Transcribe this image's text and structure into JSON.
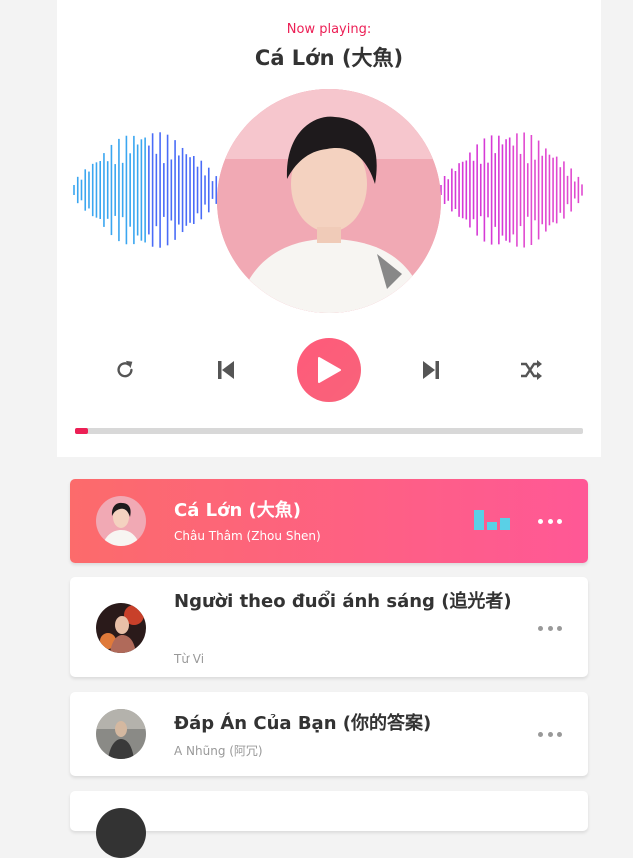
{
  "header": {
    "now_label": "Now playing:",
    "title": "Cá Lớn (大魚)"
  },
  "controls": {
    "repeat_icon": "repeat-icon",
    "prev_icon": "skip-previous-icon",
    "play_icon": "play-icon",
    "next_icon": "skip-next-icon",
    "shuffle_icon": "shuffle-icon"
  },
  "progress": {
    "value": 0.026
  },
  "colors": {
    "accent": "#ec1f55",
    "active_from": "#fc6b6b",
    "active_to": "#ff5896",
    "wave_left": "#4a6cf7",
    "wave_right": "#d63ad6"
  },
  "playlist": [
    {
      "title": "Cá Lớn (大魚)",
      "artist": "Châu Thâm (Zhou Shen)",
      "active": true
    },
    {
      "title": "Người theo đuổi ánh sáng (追光者)",
      "artist": "Từ Vi",
      "active": false
    },
    {
      "title": "Đáp Án Của Bạn (你的答案)",
      "artist": "A Nhũng (阿冗)",
      "active": false
    }
  ]
}
